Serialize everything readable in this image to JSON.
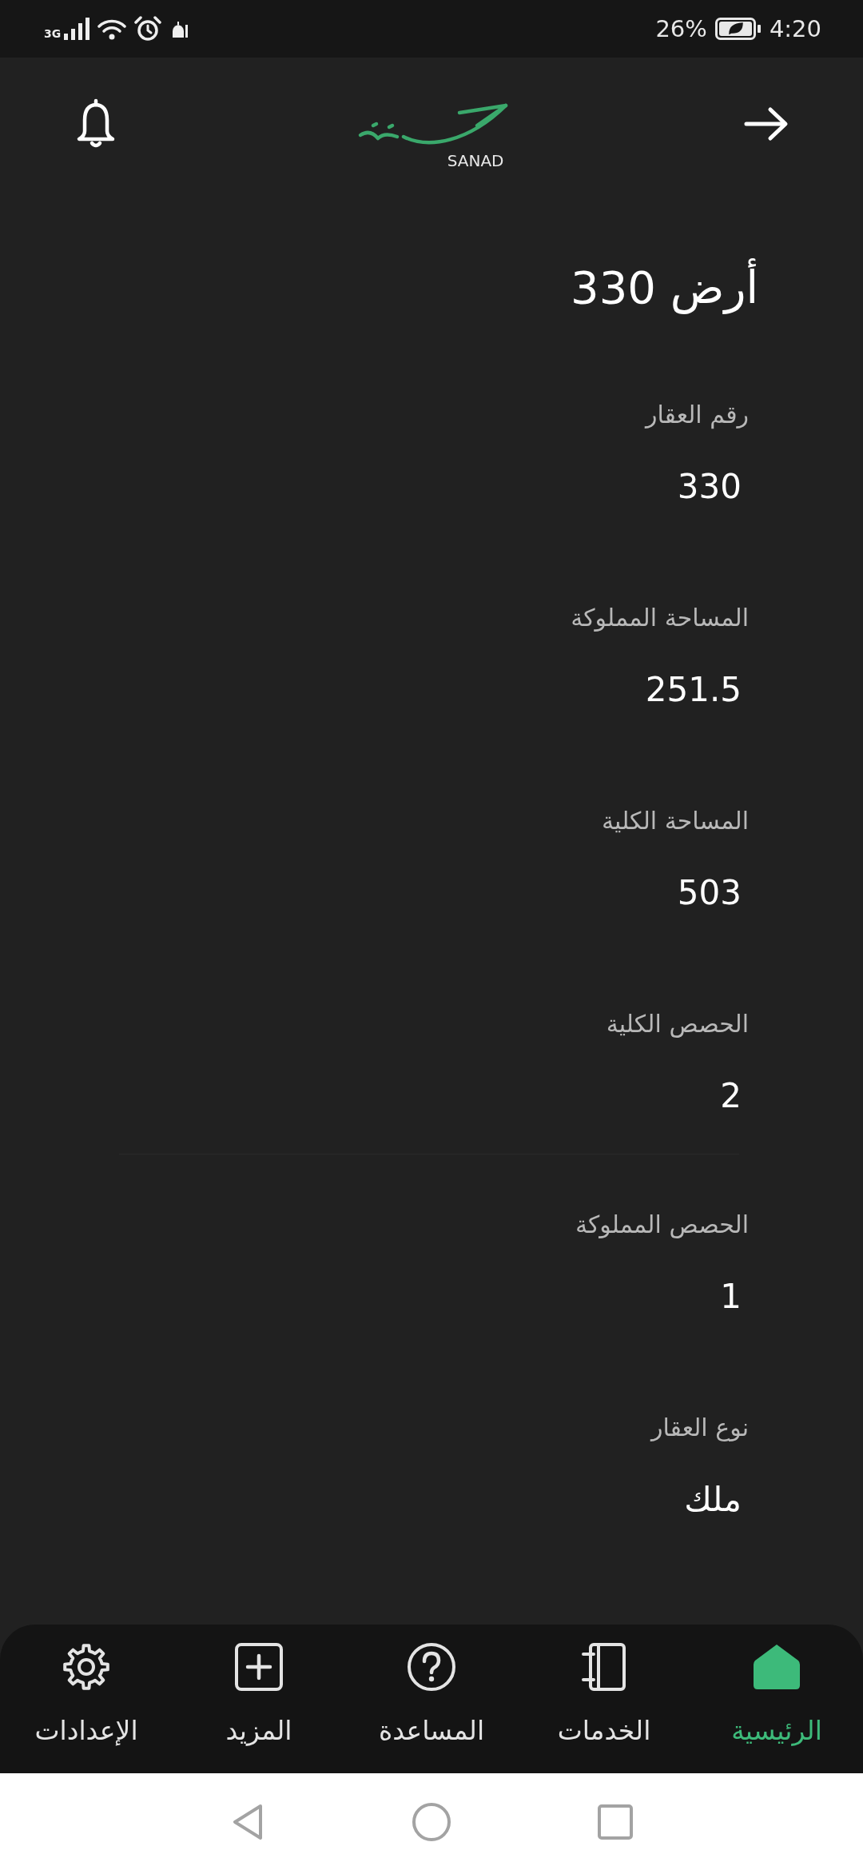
{
  "status_bar": {
    "network": "3G",
    "battery": "26%",
    "time": "4:20"
  },
  "header": {
    "logo_text": "SANAD"
  },
  "title": "أرض 330",
  "sections": [
    {
      "fields": [
        {
          "label": "رقم العقار",
          "value": "330"
        },
        {
          "label": "المساحة المملوكة",
          "value": "251.5"
        },
        {
          "label": "المساحة الكلية",
          "value": "503"
        },
        {
          "label": "الحصص الكلية",
          "value": "2"
        }
      ]
    },
    {
      "fields": [
        {
          "label": "الحصص المملوكة",
          "value": "1"
        },
        {
          "label": "نوع العقار",
          "value": "ملك"
        }
      ]
    }
  ],
  "bottom_nav": [
    {
      "label": "الرئيسية",
      "selected": true
    },
    {
      "label": "الخدمات",
      "selected": false
    },
    {
      "label": "المساعدة",
      "selected": false
    },
    {
      "label": "المزيد",
      "selected": false
    },
    {
      "label": "الإعدادات",
      "selected": false
    }
  ]
}
